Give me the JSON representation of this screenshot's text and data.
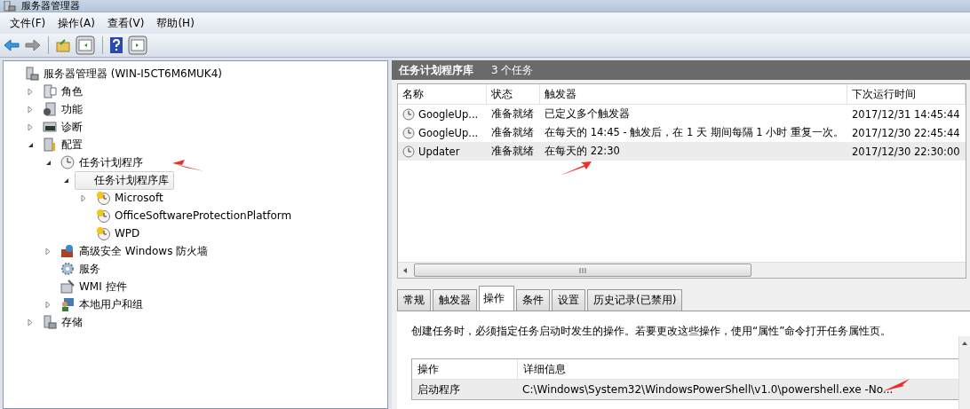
{
  "window": {
    "title": "服务器管理器"
  },
  "menu": [
    "文件(F)",
    "操作(A)",
    "查看(V)",
    "帮助(H)"
  ],
  "tree": [
    {
      "label": "服务器管理器 (WIN-I5CT6M6MUK4)",
      "kind": "server",
      "selected": false,
      "children": [
        {
          "label": "角色",
          "kind": "roles",
          "expanded": false,
          "selected": false
        },
        {
          "label": "功能",
          "kind": "features",
          "expanded": false,
          "selected": false
        },
        {
          "label": "诊断",
          "kind": "diagnostics",
          "expanded": false,
          "selected": false
        },
        {
          "label": "配置",
          "kind": "config",
          "expanded": true,
          "selected": false,
          "children": [
            {
              "label": "任务计划程序",
              "kind": "clock",
              "expanded": true,
              "selected": false,
              "children": [
                {
                  "label": "任务计划程序库",
                  "kind": "none",
                  "expanded": true,
                  "selected": true,
                  "children": [
                    {
                      "label": "Microsoft",
                      "kind": "task-folder",
                      "expanded": false,
                      "selected": false
                    },
                    {
                      "label": "OfficeSoftwareProtectionPlatform",
                      "kind": "task-folder",
                      "selected": false
                    },
                    {
                      "label": "WPD",
                      "kind": "task-folder",
                      "selected": false
                    }
                  ]
                }
              ]
            },
            {
              "label": "高级安全 Windows 防火墙",
              "kind": "firewall",
              "expanded": false,
              "selected": false
            },
            {
              "label": "服务",
              "kind": "services",
              "selected": false
            },
            {
              "label": "WMI 控件",
              "kind": "wmi",
              "selected": false
            },
            {
              "label": "本地用户和组",
              "kind": "users",
              "expanded": false,
              "selected": false
            }
          ]
        },
        {
          "label": "存储",
          "kind": "storage",
          "expanded": false,
          "selected": false
        }
      ]
    }
  ],
  "panel": {
    "title": "任务计划程序库",
    "count": "3 个任务"
  },
  "tasks": {
    "columns": [
      "名称",
      "状态",
      "触发器",
      "下次运行时间"
    ],
    "rows": [
      {
        "name": "GoogleUp...",
        "status": "准备就绪",
        "trigger": "已定义多个触发器",
        "next": "2017/12/31 14:45:44",
        "selected": false
      },
      {
        "name": "GoogleUp...",
        "status": "准备就绪",
        "trigger": "在每天的 14:45 - 触发后，在 1 天 期间每隔 1 小时 重复一次。",
        "next": "2017/12/30 22:45:44",
        "selected": false
      },
      {
        "name": "Updater",
        "status": "准备就绪",
        "trigger": "在每天的 22:30",
        "next": "2017/12/30 22:30:00",
        "selected": true
      }
    ]
  },
  "tabs": [
    {
      "label": "常规",
      "selected": false
    },
    {
      "label": "触发器",
      "selected": false
    },
    {
      "label": "操作",
      "selected": true
    },
    {
      "label": "条件",
      "selected": false
    },
    {
      "label": "设置",
      "selected": false
    },
    {
      "label": "历史记录(已禁用)",
      "selected": false
    }
  ],
  "actions": {
    "description": "创建任务时，必须指定任务启动时发生的操作。若要更改这些操作，使用“属性”命令打开任务属性页。",
    "columns": [
      "操作",
      "详细信息"
    ],
    "rows": [
      {
        "action": "启动程序",
        "details": "C:\\Windows\\System32\\WindowsPowerShell\\v1.0\\powershell.exe -No..."
      }
    ]
  }
}
